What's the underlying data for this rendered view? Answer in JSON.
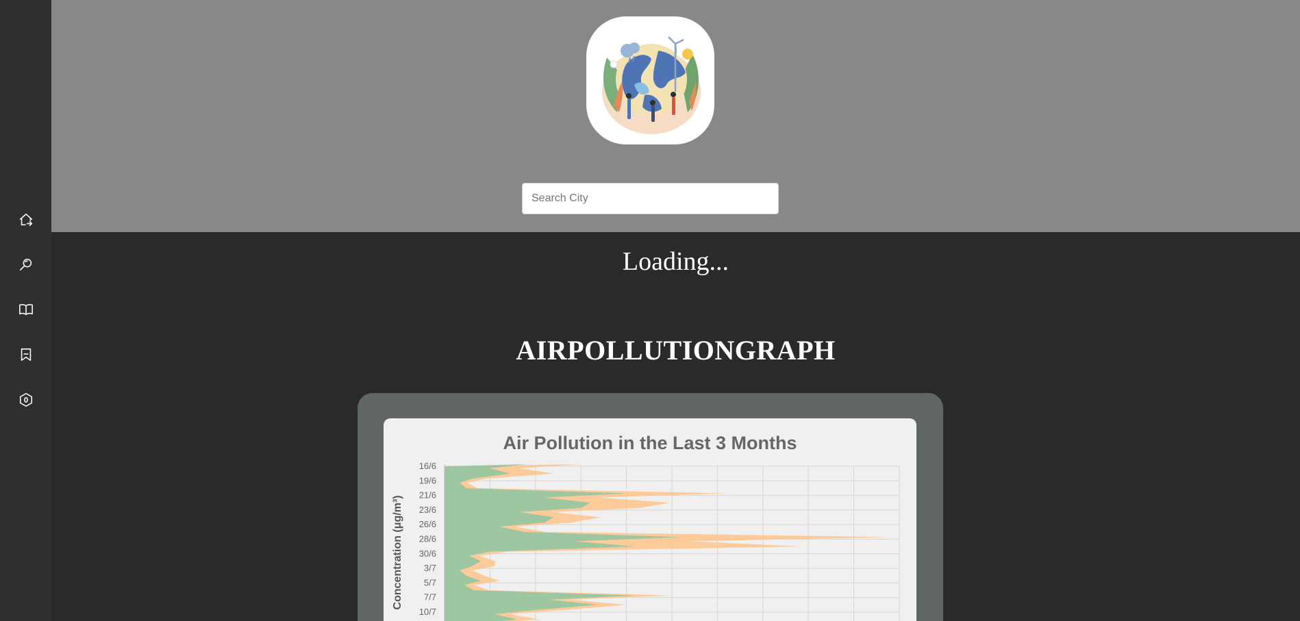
{
  "sidebar": {
    "items": [
      {
        "icon": "home-icon"
      },
      {
        "icon": "search-icon"
      },
      {
        "icon": "book-icon"
      },
      {
        "icon": "bookmark-icon"
      },
      {
        "icon": "hexagon-icon"
      }
    ]
  },
  "header": {
    "logo_icon": "earth-climate-illustration",
    "search": {
      "placeholder": "Search City",
      "value": ""
    }
  },
  "main": {
    "status_text": "Loading...",
    "section_title": "AIRPOLLUTIONGRAPH"
  },
  "colors": {
    "sidebar": "#2f2f2f",
    "header": "#888888",
    "page": "#2a2a2a",
    "panel": "#5f6664",
    "series_green": "#8dc5a2",
    "series_orange": "#ffc48a"
  },
  "chart_data": {
    "type": "area",
    "orientation": "horizontal",
    "title": "Air Pollution in the Last 3 Months",
    "ylabel": "Concentration (μg/m³)",
    "grid": true,
    "categories": [
      "16/6",
      "19/6",
      "21/6",
      "23/6",
      "26/6",
      "28/6",
      "30/6",
      "3/7",
      "5/7",
      "7/7",
      "10/7"
    ],
    "series": [
      {
        "color": "#8dc5a2",
        "values": [
          18,
          6,
          40,
          30,
          22,
          52,
          10,
          6,
          8,
          42,
          20
        ]
      },
      {
        "color": "#ffc48a",
        "values": [
          30,
          9,
          62,
          43,
          28,
          98,
          14,
          11,
          12,
          50,
          26
        ]
      }
    ],
    "xlim": [
      0,
      100
    ]
  }
}
